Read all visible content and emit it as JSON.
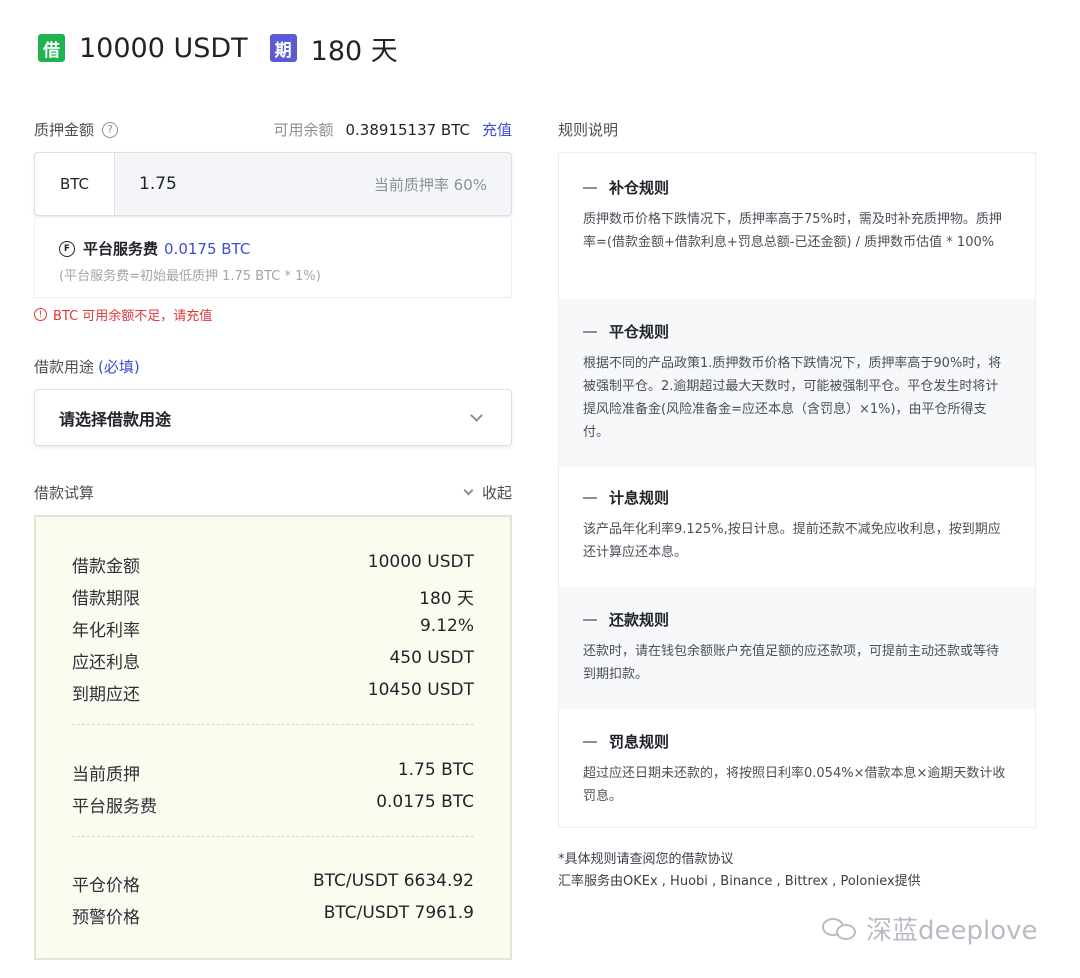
{
  "header": {
    "loan_badge": "借",
    "loan_amount": "10000 USDT",
    "term_badge": "期",
    "term": "180 天"
  },
  "collateral": {
    "label": "质押金额",
    "help_icon": "question-circle-icon",
    "balance_label": "可用余额",
    "balance_value": "0.38915137 BTC",
    "recharge_link": "充值",
    "coin": "BTC",
    "amount": "1.75",
    "ratio": "当前质押率 60%"
  },
  "fee": {
    "icon": "fee-coin-icon",
    "name": "平台服务费",
    "value": "0.0175 BTC",
    "note": "(平台服务费=初始最低质押 1.75 BTC * 1%)"
  },
  "warning": {
    "icon": "alert-circle-icon",
    "text": "BTC 可用余额不足，请充值"
  },
  "purpose": {
    "label": "借款用途",
    "required": "(必填)",
    "placeholder": "请选择借款用途"
  },
  "calculation": {
    "label": "借款试算",
    "collapse": "收起",
    "rows": [
      {
        "k": "借款金额",
        "v": "10000 USDT"
      },
      {
        "k": "借款期限",
        "v": "180 天"
      },
      {
        "k": "年化利率",
        "v": "9.12%"
      },
      {
        "k": "应还利息",
        "v": "450 USDT"
      },
      {
        "k": "到期应还",
        "v": "10450 USDT"
      },
      {
        "k": "当前质押",
        "v": "1.75 BTC"
      },
      {
        "k": "平台服务费",
        "v": "0.0175 BTC"
      },
      {
        "k": "平仓价格",
        "v": "BTC/USDT 6634.92"
      },
      {
        "k": "预警价格",
        "v": "BTC/USDT 7961.9"
      }
    ]
  },
  "rules": {
    "label": "规则说明",
    "items": [
      {
        "title": "补仓规则",
        "body": "质押数币价格下跌情况下，质押率高于75%时，需及时补充质押物。质押率=(借款金额+借款利息+罚息总额-已还金额) / 质押数币估值 * 100%"
      },
      {
        "title": "平仓规则",
        "body": "根据不同的产品政策1.质押数币价格下跌情况下，质押率高于90%时，将被强制平仓。2.逾期超过最大天数时，可能被强制平仓。平仓发生时将计提风险准备金(风险准备金=应还本息（含罚息）×1%)，由平仓所得支付。"
      },
      {
        "title": "计息规则",
        "body": "该产品年化利率9.125%,按日计息。提前还款不减免应收利息，按到期应还计算应还本息。"
      },
      {
        "title": "还款规则",
        "body": "还款时，请在钱包余额账户充值足额的应还款项，可提前主动还款或等待到期扣款。"
      },
      {
        "title": "罚息规则",
        "body": "超过应还日期未还款的，将按照日利率0.054%×借款本息×逾期天数计收罚息。"
      }
    ]
  },
  "footer": {
    "line1": "*具体规则请查阅您的借款协议",
    "line2": "汇率服务由OKEx , Huobi , Binance , Bittrex , Poloniex提供"
  },
  "watermark": {
    "icon": "wechat-icon",
    "text": "深蓝deeplove"
  }
}
